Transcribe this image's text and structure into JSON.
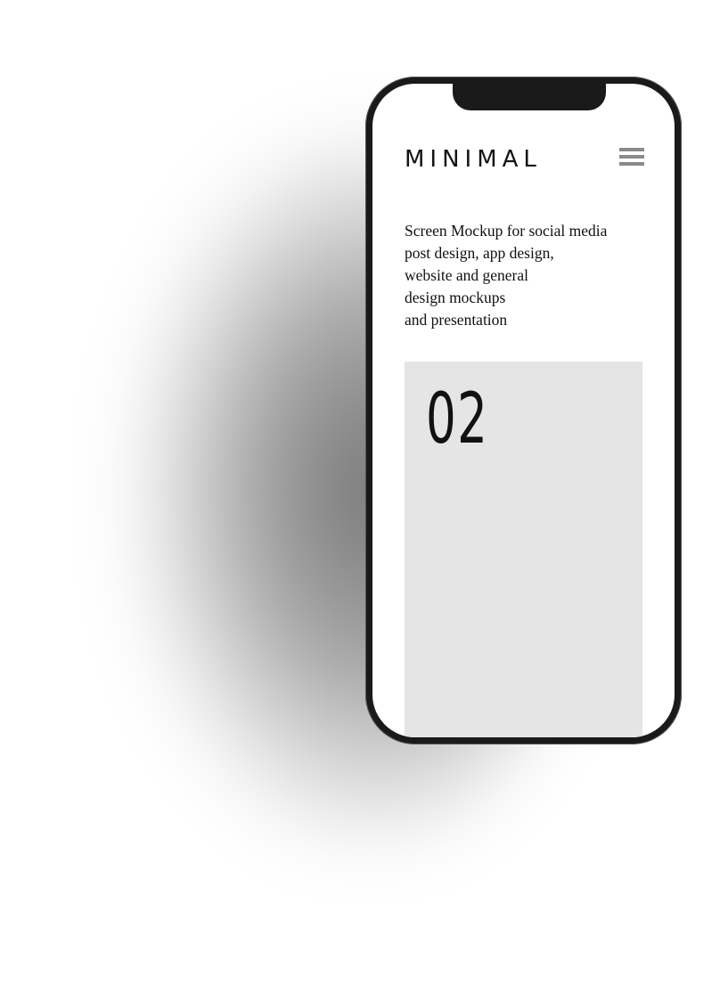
{
  "app": {
    "brand": "MINIMAL",
    "menu_icon": "hamburger-menu-icon"
  },
  "intro": {
    "lines": [
      "Screen Mockup for social media",
      "post design, app design,",
      "website and general",
      "design mockups",
      "and presentation"
    ]
  },
  "card": {
    "number": "02",
    "background": "#e5e5e5"
  },
  "colors": {
    "phone_frame": "#1a1a1a",
    "text": "#111111",
    "menu_icon": "#8a8a8a"
  }
}
